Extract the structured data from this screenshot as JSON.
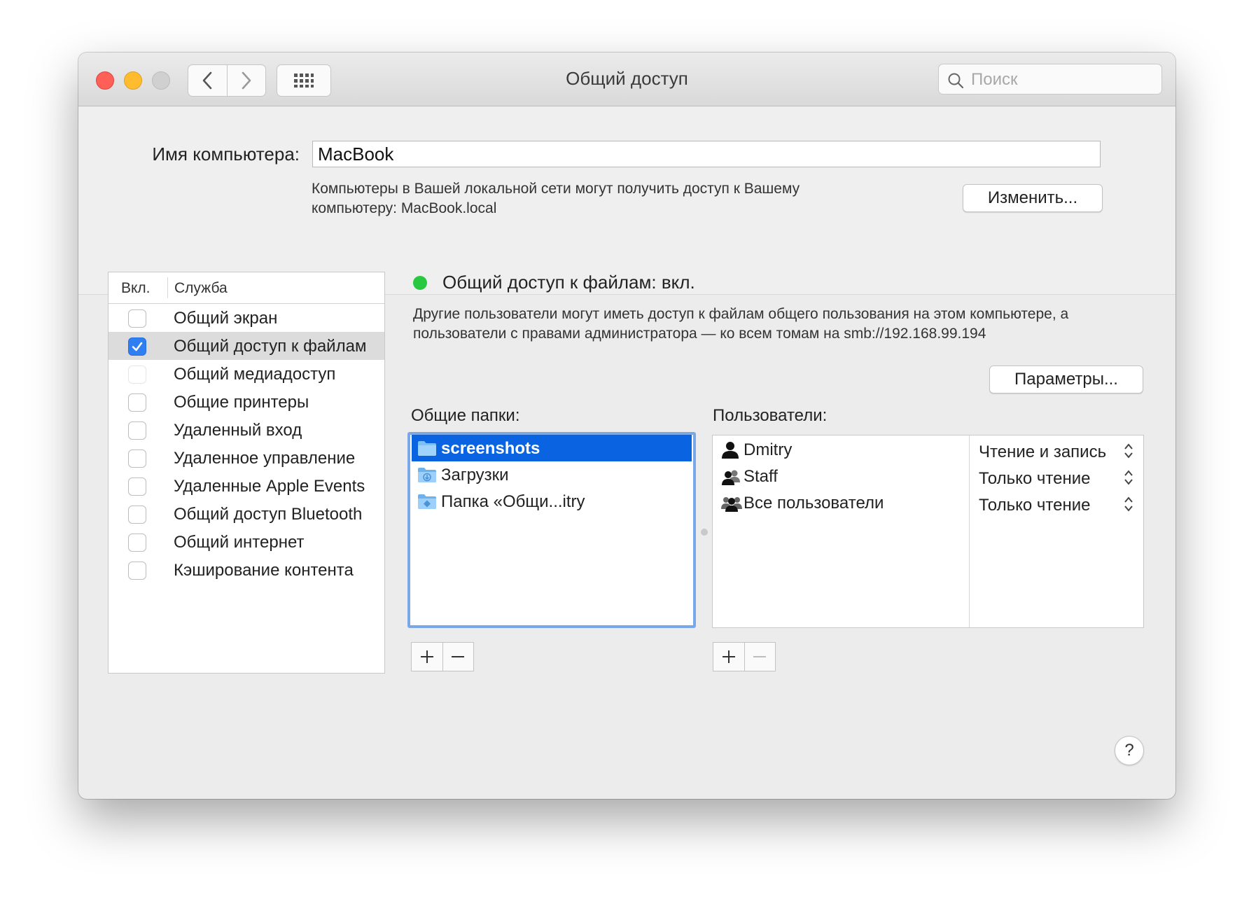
{
  "window": {
    "title": "Общий доступ"
  },
  "search": {
    "placeholder": "Поиск",
    "value": ""
  },
  "computer_name": {
    "label": "Имя компьютера:",
    "value": "MacBook",
    "description": "Компьютеры в Вашей локальной сети могут получить доступ к Вашему компьютеру: MacBook.local",
    "change_button": "Изменить..."
  },
  "services": {
    "header_on": "Вкл.",
    "header_service": "Служба",
    "items": [
      {
        "label": "Общий экран",
        "checked": false
      },
      {
        "label": "Общий доступ к файлам",
        "checked": true
      },
      {
        "label": "Общий медиадоступ",
        "checked": false
      },
      {
        "label": "Общие принтеры",
        "checked": false
      },
      {
        "label": "Удаленный вход",
        "checked": false
      },
      {
        "label": "Удаленное управление",
        "checked": false
      },
      {
        "label": "Удаленные Apple Events",
        "checked": false
      },
      {
        "label": "Общий доступ Bluetooth",
        "checked": false
      },
      {
        "label": "Общий интернет",
        "checked": false
      },
      {
        "label": "Кэширование контента",
        "checked": false
      }
    ]
  },
  "status": {
    "title": "Общий доступ к файлам: вкл.",
    "description": "Другие пользователи могут иметь доступ к файлам общего пользования на этом компьютере, а пользователи с правами администратора — ко всем томам на smb://192.168.99.194",
    "color": "#28c840"
  },
  "params_button": "Параметры...",
  "shared_folders": {
    "label": "Общие папки:",
    "items": [
      {
        "label": "screenshots",
        "icon": "folder-icon"
      },
      {
        "label": "Загрузки",
        "icon": "downloads-folder-icon"
      },
      {
        "label": "Папка «Общи...itry",
        "icon": "public-folder-icon"
      }
    ]
  },
  "users": {
    "label": "Пользователи:",
    "items": [
      {
        "name": "Dmitry",
        "permission": "Чтение и запись",
        "icon": "user-icon"
      },
      {
        "name": "Staff",
        "permission": "Только чтение",
        "icon": "group-icon"
      },
      {
        "name": "Все пользователи",
        "permission": "Только чтение",
        "icon": "everyone-icon"
      }
    ]
  },
  "colors": {
    "selection": "#0a63e1",
    "checkbox_on": "#2f7ff3",
    "focus_ring": "#7aa7e8"
  },
  "help_label": "?"
}
